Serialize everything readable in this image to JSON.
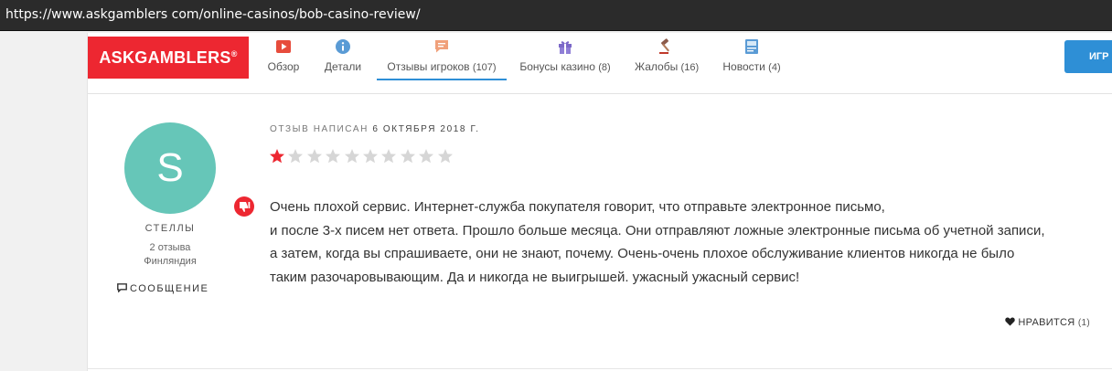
{
  "browser": {
    "url": "https://www.askgamblers com/online-casinos/bob-casino-review/"
  },
  "brand": {
    "logo_text": "ASKGAMBLERS",
    "logo_mark": "®",
    "color": "#ed2731"
  },
  "nav": {
    "tabs": [
      {
        "label": "Обзор",
        "count": "",
        "icon": "video-play-icon",
        "color": "#e74c3c"
      },
      {
        "label": "Детали",
        "count": "",
        "icon": "info-icon",
        "color": "#5a9bd5"
      },
      {
        "label": "Отзывы игроков",
        "count": "(107)",
        "icon": "comment-icon",
        "color": "#f0a07a",
        "active": true
      },
      {
        "label": "Бонусы казино",
        "count": "(8)",
        "icon": "gift-icon",
        "color": "#7b68c8"
      },
      {
        "label": "Жалобы",
        "count": "(16)",
        "icon": "gavel-icon",
        "color": "#8b5a4a"
      },
      {
        "label": "Новости",
        "count": "(4)",
        "icon": "news-icon",
        "color": "#5a9bd5"
      }
    ],
    "cta_label": "ИГР",
    "accent": "#2e8fd6"
  },
  "review": {
    "posted_prefix": "ОТЗЫВ НАПИСАН",
    "posted_date": "6 ОКТЯБРЯ 2018 Г.",
    "rating": 1,
    "rating_max": 10,
    "text_lines": [
      "Очень плохой сервис. Интернет-служба покупателя говорит, что отправьте электронное письмо,",
      "и после 3-х писем нет ответа. Прошло больше месяца. Они отправляют ложные электронные письма об учетной записи,",
      "а затем, когда вы спрашиваете, они не знают, почему. Очень-очень плохое обслуживание клиентов никогда не было",
      "таким разочаровывающим. Да и никогда не выигрышей. ужасный ужасный сервис!"
    ],
    "like_label": "НРАВИТСЯ",
    "like_count": "(1)"
  },
  "author": {
    "initial": "S",
    "avatar_color": "#66c6b8",
    "name": "СТЕЛЛЫ",
    "reviews": "2 отзыва",
    "country": "Финляндия",
    "message_label": "СООБЩЕНИЕ"
  }
}
